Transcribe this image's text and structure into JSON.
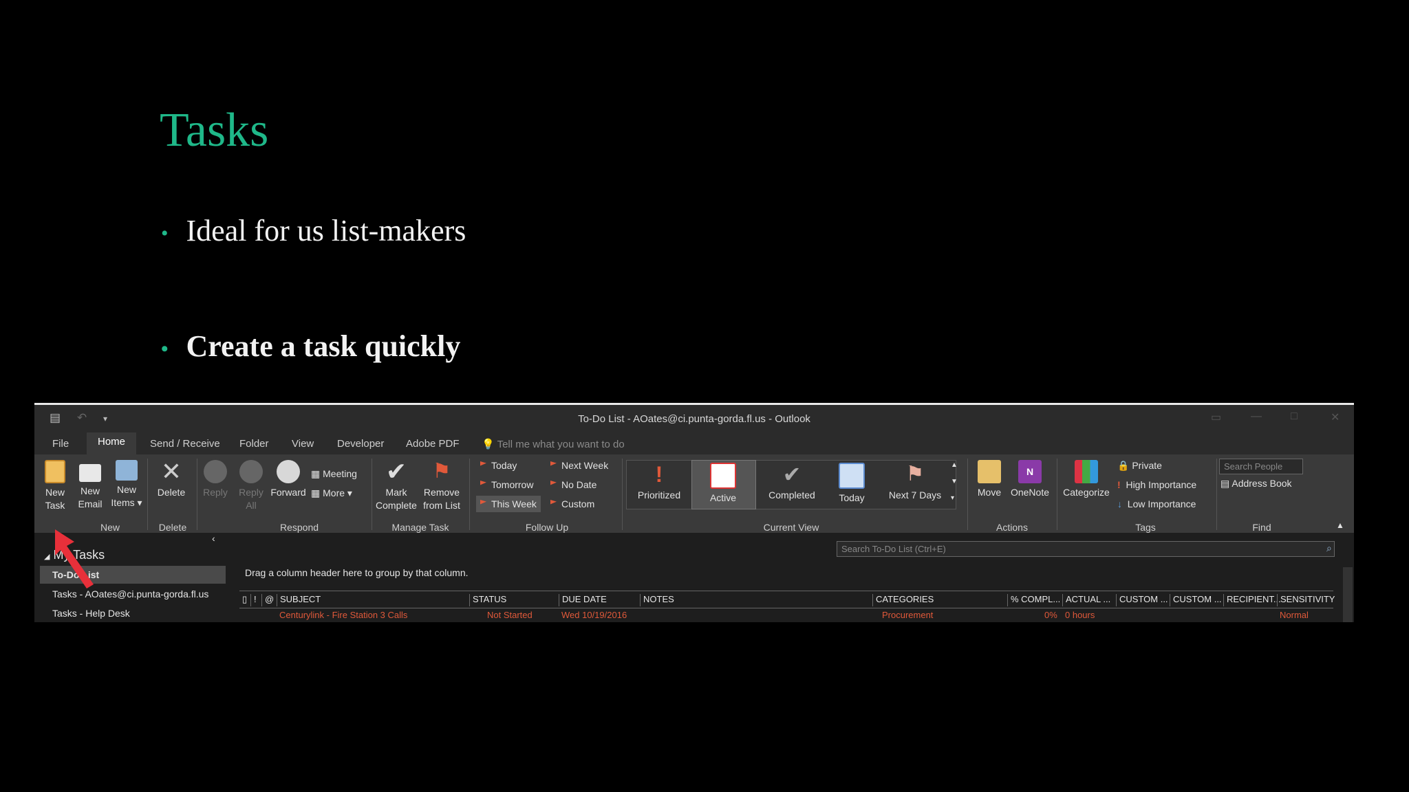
{
  "slide": {
    "title": "Tasks",
    "bullets": [
      "Ideal for us list-makers",
      "Create a task quickly"
    ]
  },
  "window": {
    "title": "To-Do List - AOates@ci.punta-gorda.fl.us - Outlook",
    "qat_icons": [
      "save-icon",
      "undo-icon",
      "customize-qat-icon"
    ]
  },
  "tabs": [
    "File",
    "Home",
    "Send / Receive",
    "Folder",
    "View",
    "Developer",
    "Adobe PDF"
  ],
  "active_tab": "Home",
  "tell_me": "Tell me what you want to do",
  "ribbon": {
    "new": {
      "group": "New",
      "buttons": [
        {
          "label1": "New",
          "label2": "Task"
        },
        {
          "label1": "New",
          "label2": "Email"
        },
        {
          "label1": "New",
          "label2": "Items ▾"
        }
      ]
    },
    "delete": {
      "group": "Delete",
      "button": "Delete"
    },
    "respond": {
      "group": "Respond",
      "reply": "Reply",
      "reply_all1": "Reply",
      "reply_all2": "All",
      "forward": "Forward",
      "meeting": "Meeting",
      "more": "More ▾"
    },
    "manage": {
      "group": "Manage Task",
      "mark1": "Mark",
      "mark2": "Complete",
      "remove1": "Remove",
      "remove2": "from List"
    },
    "followup": {
      "group": "Follow Up",
      "items": [
        "Today",
        "Tomorrow",
        "This Week",
        "Next Week",
        "No Date",
        "Custom"
      ]
    },
    "current_view": {
      "group": "Current View",
      "items": [
        "Prioritized",
        "Active",
        "Completed",
        "Today",
        "Next 7 Days"
      ],
      "selected": "Active"
    },
    "actions": {
      "group": "Actions",
      "move": "Move",
      "onenote": "OneNote"
    },
    "tags": {
      "group": "Tags",
      "categorize": "Categorize",
      "private": "Private",
      "high": "High Importance",
      "low": "Low Importance"
    },
    "find": {
      "group": "Find",
      "search_people": "Search People",
      "address_book": "Address Book"
    }
  },
  "nav": {
    "header": "My Tasks",
    "items": [
      "To-Do List",
      "Tasks - AOates@ci.punta-gorda.fl.us",
      "Tasks - Help Desk"
    ]
  },
  "content": {
    "search_placeholder": "Search To-Do List (Ctrl+E)",
    "drag_hint": "Drag a column header here to group by that column.",
    "columns": [
      "SUBJECT",
      "STATUS",
      "DUE DATE",
      "NOTES",
      "CATEGORIES",
      "% COMPL...",
      "ACTUAL ...",
      "CUSTOM ...",
      "CUSTOM ...",
      "RECIPIENT...",
      "SENSITIVITY"
    ],
    "row": {
      "subject": "Centurylink - Fire Station 3 Calls",
      "status": "Not Started",
      "due": "Wed 10/19/2016",
      "category": "Procurement",
      "pct": "0%",
      "actual": "0 hours",
      "sensitivity": "Normal"
    }
  },
  "colors": {
    "accent": "#1fb889",
    "flag": "#e0593a",
    "arrow": "#e8303a"
  }
}
